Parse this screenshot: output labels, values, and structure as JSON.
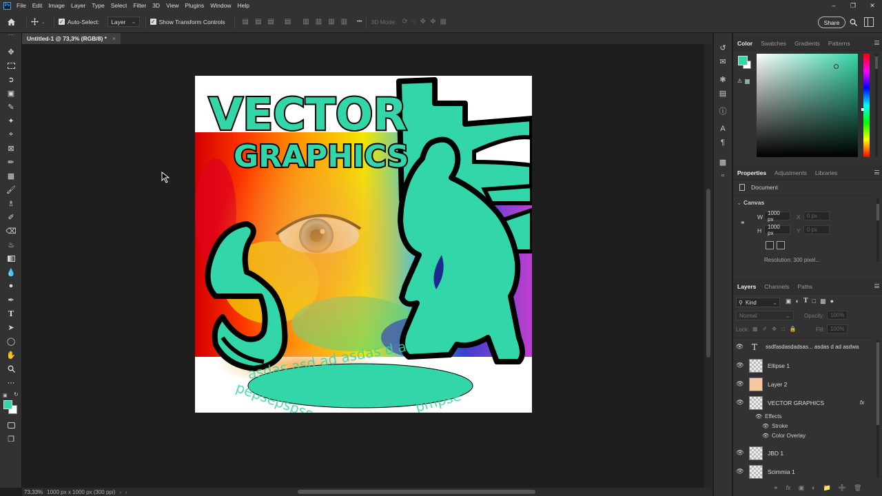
{
  "app": {
    "logo": "Ps",
    "menu": [
      "File",
      "Edit",
      "Image",
      "Layer",
      "Type",
      "Select",
      "Filter",
      "3D",
      "View",
      "Plugins",
      "Window",
      "Help"
    ],
    "window_controls": [
      "–",
      "❐",
      "✕"
    ]
  },
  "options_bar": {
    "auto_select_label": "Auto-Select:",
    "auto_select_target": "Layer",
    "show_transform_label": "Show Transform Controls",
    "more": "•••",
    "mode_3d_label": "3D Mode:",
    "share_label": "Share"
  },
  "document": {
    "tab_title": "Untitled-1 @ 73,3% (RGB/8) *",
    "tab_close": "×"
  },
  "artwork": {
    "title_line1": "VECTOR",
    "title_line2": "GRAPHICS",
    "arc_text_top": "asdas asd ad asdas d ad",
    "arc_text_bottom": "pepsepspsss",
    "arc_text_right": "pmpse",
    "accent_color": "#33d6a8"
  },
  "status_bar": {
    "zoom": "73,33%",
    "doc_info": "1000 px x 1000 px (300 ppi)"
  },
  "color_panel": {
    "tabs": [
      "Color",
      "Swatches",
      "Gradients",
      "Patterns"
    ],
    "foreground": "#33d6a8",
    "background": "#ffffff"
  },
  "properties_panel": {
    "tabs": [
      "Properties",
      "Adjustments",
      "Libraries"
    ],
    "document_label": "Document",
    "section_label": "Canvas",
    "w_label": "W",
    "w_value": "1000 px",
    "h_label": "H",
    "h_value": "1000 px",
    "x_label": "X",
    "x_placeholder": "0 px",
    "y_label": "Y",
    "y_placeholder": "0 px",
    "resolution": "Resolution: 300 pixel..."
  },
  "layers_panel": {
    "tabs": [
      "Layers",
      "Channels",
      "Paths"
    ],
    "kind_filter": "Kind",
    "blend_mode": "Normal",
    "opacity_label": "Opacity:",
    "opacity_value": "100%",
    "lock_label": "Lock:",
    "fill_label": "Fill:",
    "fill_value": "100%",
    "layers": [
      {
        "name": "ssdfasdasdadsas... asdas d ad asdwa",
        "type": "text"
      },
      {
        "name": "Ellipse 1",
        "type": "shape"
      },
      {
        "name": "Layer 2",
        "type": "pixel"
      },
      {
        "name": "VECTOR GRAPHICS",
        "type": "text",
        "fx": "fx"
      },
      {
        "name": "JBD 1",
        "type": "shape"
      },
      {
        "name": "Scimmia 1",
        "type": "shape"
      }
    ],
    "effects_label": "Effects",
    "effect_items": [
      "Stroke",
      "Color Overlay"
    ]
  }
}
